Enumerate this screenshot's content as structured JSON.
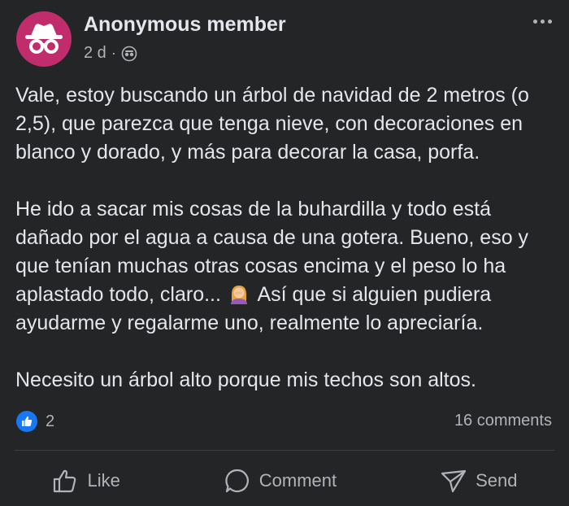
{
  "post": {
    "author": "Anonymous member",
    "time": "2 d",
    "separator": "·",
    "audience_icon": "anonymous-icon",
    "paragraphs": {
      "p1": "Vale, estoy buscando un árbol de navidad de 2 metros (o 2,5), que parezca que tenga nieve, con decoraciones en blanco y dorado, y más para decorar la casa, porfa.",
      "p2_before_emoji": "He ido a sacar mis cosas de la buhardilla y todo está dañado por el agua a causa de una gotera. Bueno, eso y que tenían muchas otras cosas encima y el peso lo ha aplastado todo, claro...",
      "p2_after_emoji": "Así que si alguien pudiera ayudarme y regalarme uno, realmente lo apreciaría.",
      "p3": "Necesito un árbol alto porque mis techos son altos."
    },
    "emoji": "woman-facepalming-emoji"
  },
  "reactions": {
    "count": "2",
    "comments": "16 comments"
  },
  "actions": {
    "like": "Like",
    "comment": "Comment",
    "send": "Send"
  },
  "colors": {
    "background": "#242526",
    "avatar": "#c02c6c",
    "like_blue": "#1877f2",
    "text": "#e4e6eb",
    "muted": "#b0b3b8"
  }
}
